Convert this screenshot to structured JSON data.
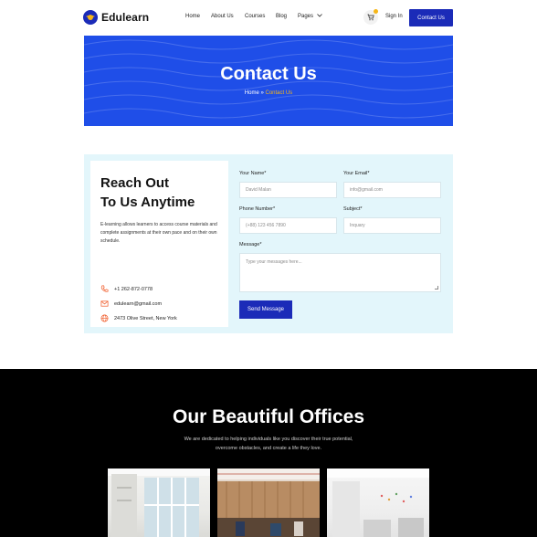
{
  "header": {
    "brand": "Edulearn",
    "nav": [
      "Home",
      "About Us",
      "Courses",
      "Blog",
      "Pages"
    ],
    "signin": "Sign In",
    "contact_button": "Contact Us",
    "brand_color": "#1b2bb8",
    "accent_color": "#f6b617"
  },
  "hero": {
    "title": "Contact Us",
    "breadcrumb_home": "Home",
    "breadcrumb_separator": "»",
    "breadcrumb_current": "Contact Us",
    "background": "#1f4ee8"
  },
  "contact": {
    "heading_line1": "Reach Out",
    "heading_line2": "To Us Anytime",
    "description": "E-learning allows learners to access course materials and complete assignments at their own pace and on their own schedule.",
    "phone": "+1 262-872-0778",
    "email": "edulearn@gmail.com",
    "address": "2473 Olive Street, New York",
    "form": {
      "name_label": "Your Name*",
      "name_placeholder": "David Malan",
      "email_label": "Your Email*",
      "email_placeholder": "info@gmail.com",
      "phone_label": "Phone Number*",
      "phone_placeholder": "(+88) 123 456 7890",
      "subject_label": "Subject*",
      "subject_placeholder": "Inquary",
      "message_label": "Message*",
      "message_placeholder": "Type your messages here...",
      "submit": "Send Message"
    }
  },
  "offices": {
    "title": "Our Beautiful Offices",
    "description": "We are dedicated to helping individuals like you discover their true potential, overcome obstacles, and create a life they love."
  }
}
